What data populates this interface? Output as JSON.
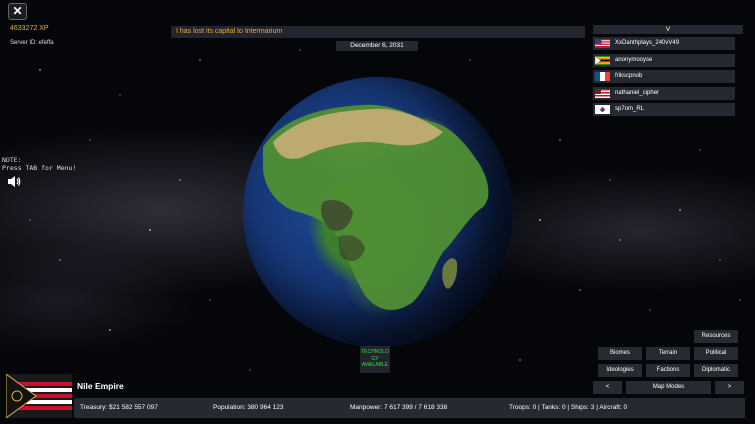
{
  "hud": {
    "close_label": "✕",
    "xp": "4633272 XP",
    "server_id": "Server ID: efeffa",
    "note": "NOTE:\nPress TAB for Menu!"
  },
  "notification": "I has lost its capital to Intermarium",
  "date": "December 6, 2031",
  "player_list": {
    "toggle_label": "V",
    "players": [
      {
        "name": "XxDanthplays_240vV49",
        "flag": "usa"
      },
      {
        "name": "anonymooyse",
        "flag": "zimbabwe"
      },
      {
        "name": "frikscpnob",
        "flag": "france"
      },
      {
        "name": "nathaniel_cipher",
        "flag": "custom"
      },
      {
        "name": "sp7om_RL",
        "flag": "south-korea"
      }
    ]
  },
  "tech_notice": "TECHNOLO GY AVAILABLE",
  "map_modes": {
    "resources": "Resources",
    "biomes": "Biomes",
    "terrain": "Terrain",
    "political": "Political",
    "ideologies": "Ideologies",
    "factions": "Factions",
    "diplomatic": "Diplomatic",
    "prev": "<",
    "label": "Map Modes",
    "next": ">"
  },
  "nation": {
    "name": "Nile Empire",
    "treasury": "Treasury:  $21 582 557 097",
    "population": "Population: 380 964 123",
    "manpower": "Manpower:  7 617 399  /  7 618 338",
    "military": "Troops: 0  |  Tanks: 0  |  Ships: 3  |  Aircraft: 0"
  },
  "colors": {
    "xp": "#e8b24a",
    "notification_text": "#f0a640",
    "tech_text": "#39e03a",
    "panel_bg": "#282c34"
  }
}
